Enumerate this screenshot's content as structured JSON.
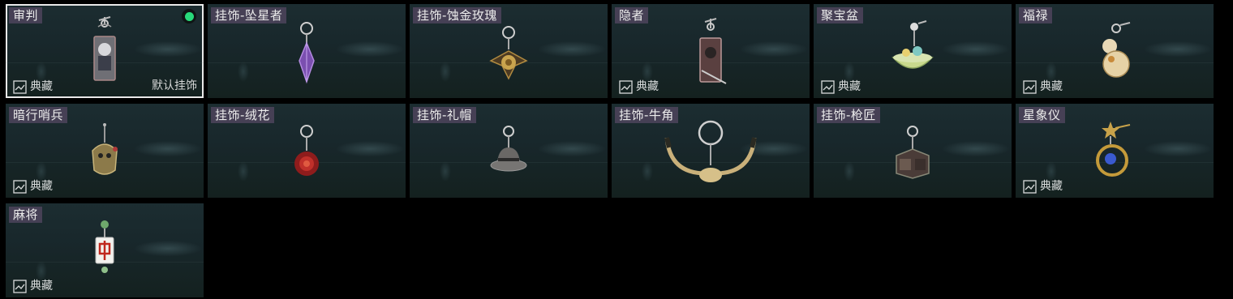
{
  "cards": [
    {
      "name": "审判",
      "collect_label": "典藏",
      "default_label": "默认挂饰",
      "equipped": true,
      "icon": "judgment-tarot-charm-icon"
    },
    {
      "name": "挂饰-坠星者",
      "icon": "purple-crystal-charm-icon"
    },
    {
      "name": "挂饰-蚀金玫瑰",
      "icon": "gold-rose-charm-icon"
    },
    {
      "name": "隐者",
      "collect_label": "典藏",
      "icon": "hermit-tarot-charm-icon"
    },
    {
      "name": "聚宝盆",
      "collect_label": "典藏",
      "icon": "treasure-bowl-charm-icon"
    },
    {
      "name": "福禄",
      "collect_label": "典藏",
      "icon": "gourd-charm-icon"
    },
    {
      "name": "暗行哨兵",
      "collect_label": "典藏",
      "icon": "sentinel-charm-icon"
    },
    {
      "name": "挂饰-绒花",
      "icon": "red-flower-charm-icon"
    },
    {
      "name": "挂饰-礼帽",
      "icon": "top-hat-charm-icon"
    },
    {
      "name": "挂饰-牛角",
      "icon": "bull-horn-charm-icon"
    },
    {
      "name": "挂饰-枪匠",
      "icon": "gunsmith-chest-charm-icon"
    },
    {
      "name": "星象仪",
      "collect_label": "典藏",
      "icon": "astrolabe-charm-icon"
    },
    {
      "name": "麻将",
      "collect_label": "典藏",
      "icon": "mahjong-tile-charm-icon"
    }
  ],
  "colors": {
    "equipped_dot": "#28d97a",
    "selected_border": "#e9e9e9",
    "name_tag_bg": "#4e445c"
  }
}
